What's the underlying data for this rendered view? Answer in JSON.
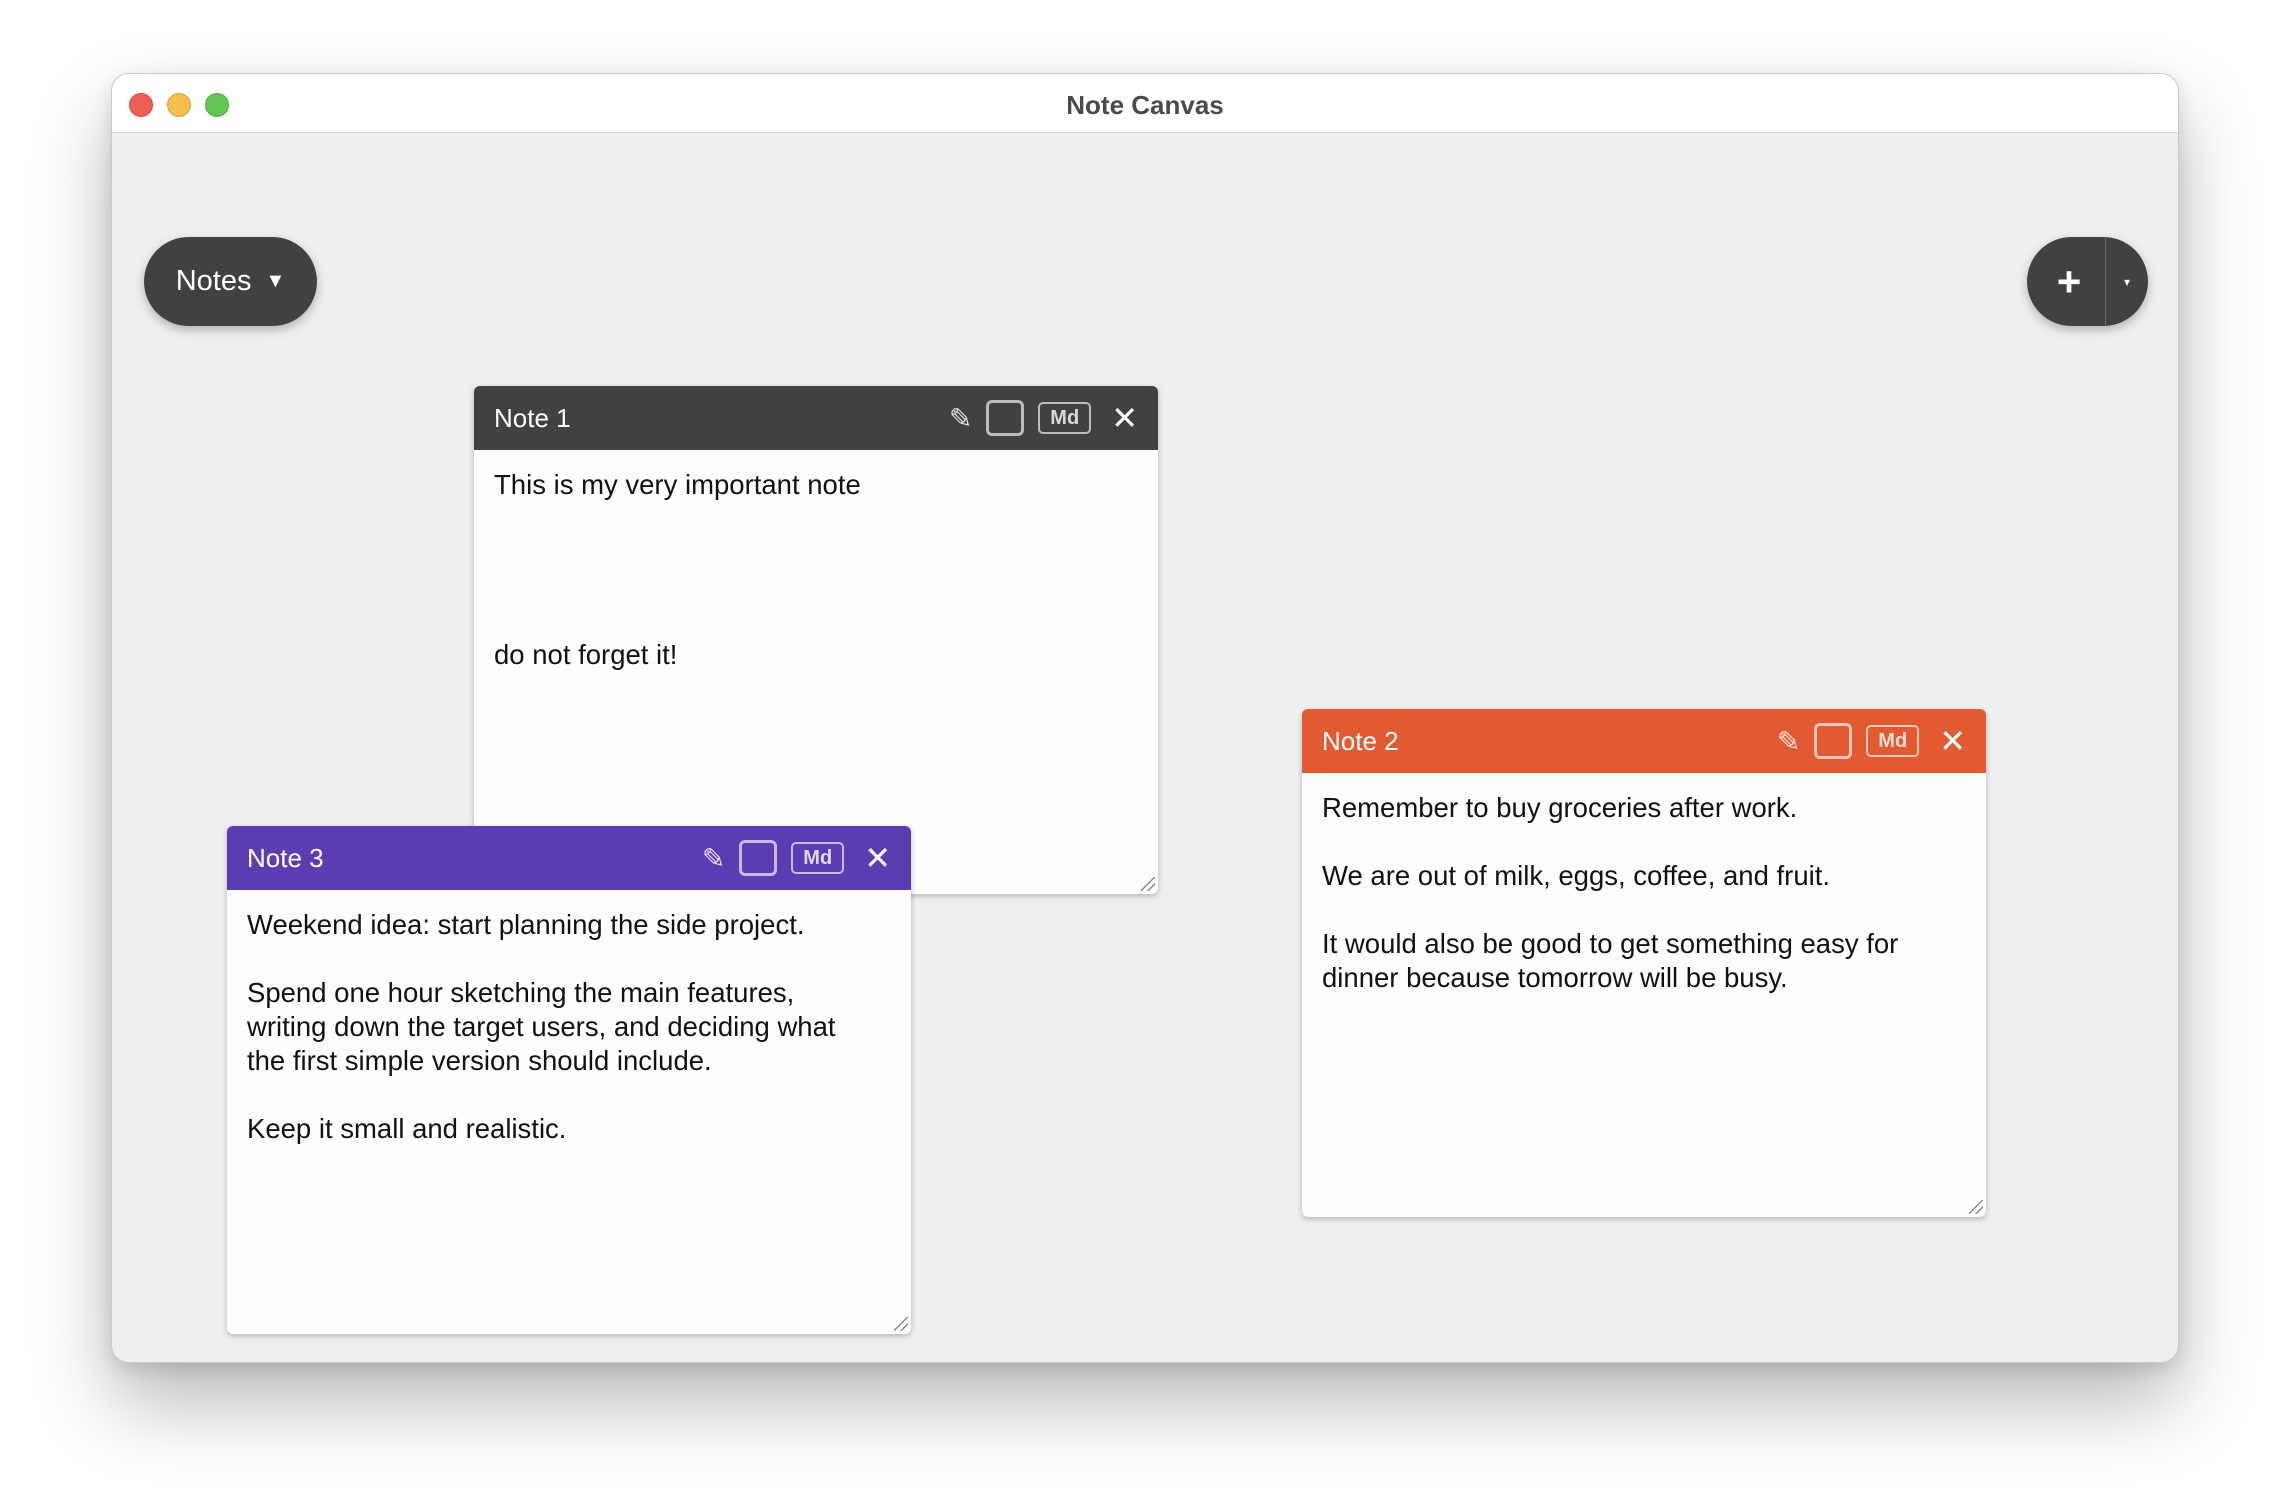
{
  "window": {
    "title": "Note Canvas"
  },
  "toolbar": {
    "notes_menu_label": "Notes",
    "notes_menu_caret": "▼",
    "add_label": "+",
    "add_caret": "▾"
  },
  "notes": [
    {
      "title": "Note 1",
      "color": "#414141",
      "pencil": "✎",
      "md_label": "Md",
      "close": "✕",
      "body": "This is my very important note\n\n\n\n\ndo not forget it!"
    },
    {
      "title": "Note 2",
      "color": "#e15a32",
      "pencil": "✎",
      "md_label": "Md",
      "close": "✕",
      "body": "Remember to buy groceries after work.\n\nWe are out of milk, eggs, coffee, and fruit.\n\nIt would also be good to get something easy for\ndinner because tomorrow will be busy."
    },
    {
      "title": "Note 3",
      "color": "#5a3db0",
      "pencil": "✎",
      "md_label": "Md",
      "close": "✕",
      "body": "Weekend idea: start planning the side project.\n\nSpend one hour sketching the main features,\nwriting down the target users, and deciding what\nthe first simple version should include.\n\nKeep it small and realistic."
    }
  ]
}
